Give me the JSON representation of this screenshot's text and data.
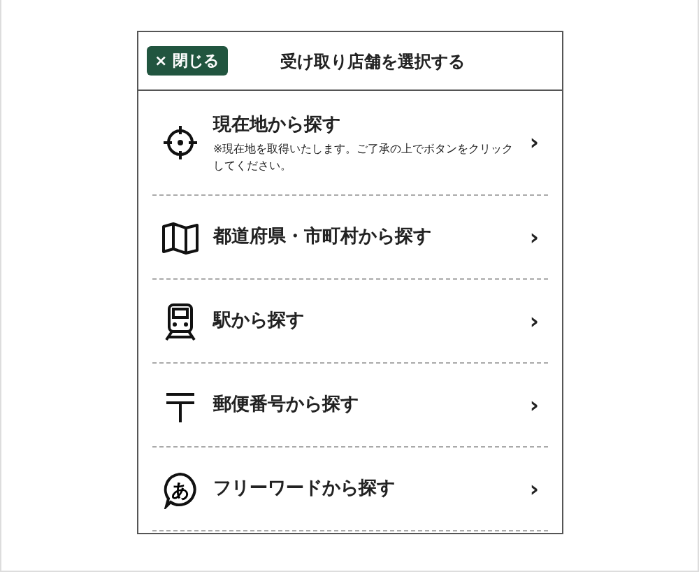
{
  "header": {
    "close_button": "× 閉じる",
    "title": "受け取り店舗を選択する"
  },
  "items": [
    {
      "kind": "locate",
      "label": "現在地から探す",
      "note": "※現在地を取得いたします。ご了承の上でボタンをクリックしてください。",
      "chevron": "›"
    },
    {
      "kind": "map",
      "label": "都道府県・市町村から探す",
      "chevron": "›"
    },
    {
      "kind": "train",
      "label": "駅から探す",
      "chevron": "›"
    },
    {
      "kind": "postal",
      "label": "郵便番号から探す",
      "chevron": "›"
    },
    {
      "kind": "keyword",
      "label": "フリーワードから探す",
      "icon_text": "あ",
      "chevron": "›"
    }
  ]
}
